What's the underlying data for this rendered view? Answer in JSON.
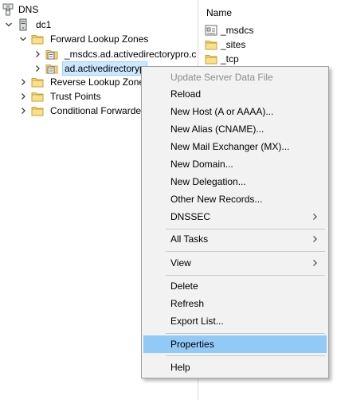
{
  "tree": {
    "root": {
      "label": "DNS",
      "icon": "dns-icon"
    },
    "server": {
      "label": "dc1",
      "icon": "server-icon"
    },
    "forward_zones": {
      "label": "Forward Lookup Zones",
      "icon": "folder-icon"
    },
    "zone_msdcs": {
      "label": "_msdcs.ad.activedirectorypro.co",
      "icon": "zone-icon"
    },
    "zone_ad": {
      "label": "ad.activedirectoryp",
      "icon": "zone-icon"
    },
    "reverse_zones": {
      "label": "Reverse Lookup Zones",
      "icon": "folder-icon"
    },
    "trust_points": {
      "label": "Trust Points",
      "icon": "folder-icon"
    },
    "conditional_forwarders": {
      "label": "Conditional Forwarder",
      "icon": "folder-icon"
    }
  },
  "list": {
    "column_header": "Name",
    "items": [
      {
        "label": "_msdcs",
        "icon": "zone-icon"
      },
      {
        "label": "_sites",
        "icon": "folder-icon"
      },
      {
        "label": "_tcp",
        "icon": "folder-icon"
      }
    ]
  },
  "context_menu": {
    "items": [
      {
        "label": "Update Server Data File",
        "disabled": true
      },
      {
        "label": "Reload"
      },
      {
        "label": "New Host (A or AAAA)..."
      },
      {
        "label": "New Alias (CNAME)..."
      },
      {
        "label": "New Mail Exchanger (MX)..."
      },
      {
        "label": "New Domain..."
      },
      {
        "label": "New Delegation..."
      },
      {
        "label": "Other New Records..."
      },
      {
        "label": "DNSSEC",
        "submenu": true
      },
      {
        "label": "All Tasks",
        "submenu": true
      },
      {
        "label": "View",
        "submenu": true
      },
      {
        "label": "Delete"
      },
      {
        "label": "Refresh"
      },
      {
        "label": "Export List..."
      },
      {
        "label": "Properties",
        "highlighted": true
      },
      {
        "label": "Help"
      }
    ]
  },
  "colors": {
    "menu_background": "#f2f2f2",
    "menu_highlight": "#91c9f7",
    "disabled_text": "#8c8c8c",
    "folder_yellow": "#f8d775",
    "selection": "#cce8ff"
  }
}
